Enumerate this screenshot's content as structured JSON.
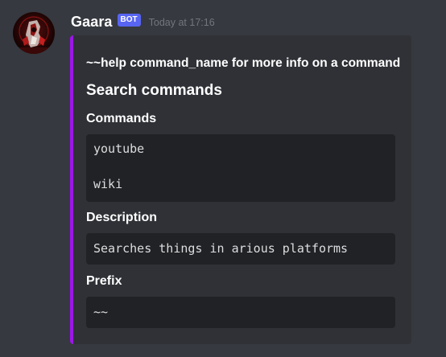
{
  "message": {
    "author": {
      "name": "Gaara",
      "bot_tag": "BOT",
      "avatar_icon": "gaara-avatar-icon"
    },
    "timestamp": "Today at 17:16",
    "embed": {
      "accent_color": "#9c17e6",
      "title": "~~help command_name for more info on a command",
      "category": "Search commands",
      "fields": [
        {
          "name": "Commands",
          "lines": [
            "youtube",
            "wiki"
          ]
        },
        {
          "name": "Description",
          "lines": [
            "Searches things in arious platforms"
          ]
        },
        {
          "name": "Prefix",
          "lines": [
            "~~"
          ]
        }
      ]
    }
  },
  "colors": {
    "background": "#36393f",
    "embed_background": "#2f3136",
    "code_background": "#202225",
    "bot_tag": "#5865f2",
    "timestamp": "#72767d"
  }
}
